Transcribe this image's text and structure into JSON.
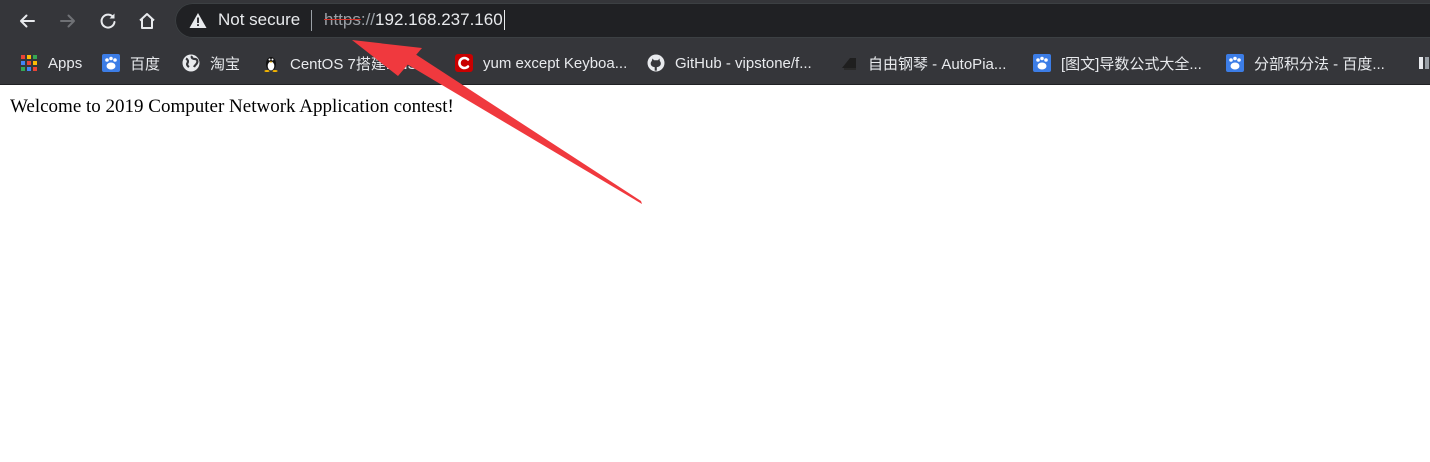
{
  "omnibox": {
    "security_label": "Not secure",
    "url_scheme": "https",
    "url_separator": "://",
    "url_host": "192.168.237.160"
  },
  "bookmarks": [
    {
      "label": "Apps",
      "icon": "apps-grid-icon"
    },
    {
      "label": "百度",
      "icon": "baidu-paw-icon"
    },
    {
      "label": "淘宝",
      "icon": "globe-icon"
    },
    {
      "label": "CentOS 7搭建DNS...",
      "icon": "tux-penguin-icon"
    },
    {
      "label": "yum except Keyboa...",
      "icon": "csdn-c-icon"
    },
    {
      "label": "GitHub - vipstone/f...",
      "icon": "github-octocat-icon"
    },
    {
      "label": "自由钢琴 - AutoPia...",
      "icon": "piano-icon"
    },
    {
      "label": "[图文]导数公式大全...",
      "icon": "baidu-paw-icon"
    },
    {
      "label": "分部积分法 - 百度...",
      "icon": "baidu-paw-icon"
    }
  ],
  "page": {
    "welcome_text": "Welcome to 2019 Computer Network Application contest!"
  },
  "colors": {
    "toolbar_bg": "#35363a",
    "omnibox_bg": "#202124",
    "text_light": "#e8eaed",
    "muted": "#9aa0a6",
    "strike_red": "#d93025",
    "annotation_arrow": "#f0393e"
  }
}
